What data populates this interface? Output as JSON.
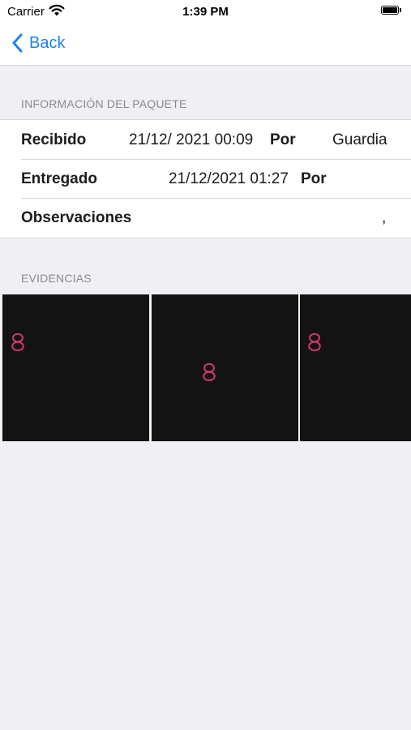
{
  "status_bar": {
    "carrier": "Carrier",
    "time": "1:39 PM",
    "wifi_icon": "wifi-icon",
    "battery_icon": "battery-full-icon"
  },
  "nav": {
    "back_label": "Back",
    "back_icon": "chevron-left-icon",
    "accent_color": "#1a82f4"
  },
  "package_info": {
    "header": "INFORMACIÓN DEL PAQUETE",
    "rows": [
      {
        "label": "Recibido",
        "value": "21/12/ 2021 00:09",
        "by_label": "Por",
        "by_value": "Guardia"
      },
      {
        "label": "Entregado",
        "value": "21/12/2021 01:27",
        "by_label": "Por",
        "by_value": ""
      },
      {
        "label": "Observaciones",
        "value": ","
      }
    ]
  },
  "evidence": {
    "header": "EVIDENCIAS",
    "images": [
      {
        "name": "evidence-image-1",
        "glyph": "placeholder-eight-icon"
      },
      {
        "name": "evidence-image-2",
        "glyph": "placeholder-eight-icon"
      },
      {
        "name": "evidence-image-3",
        "glyph": "placeholder-eight-icon"
      }
    ],
    "glyph_color": "#d2386a"
  }
}
